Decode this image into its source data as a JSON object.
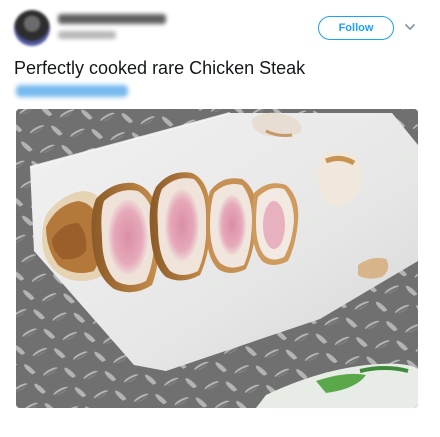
{
  "tweet": {
    "text": "Perfectly cooked rare Chicken Steak",
    "follow_label": "Follow",
    "icons": {
      "avatar": "blurred-user-avatar",
      "menu": "chevron-down-icon"
    },
    "colors": {
      "accent": "#1da1f2",
      "text": "#14171a",
      "muted": "#8899a6"
    }
  }
}
